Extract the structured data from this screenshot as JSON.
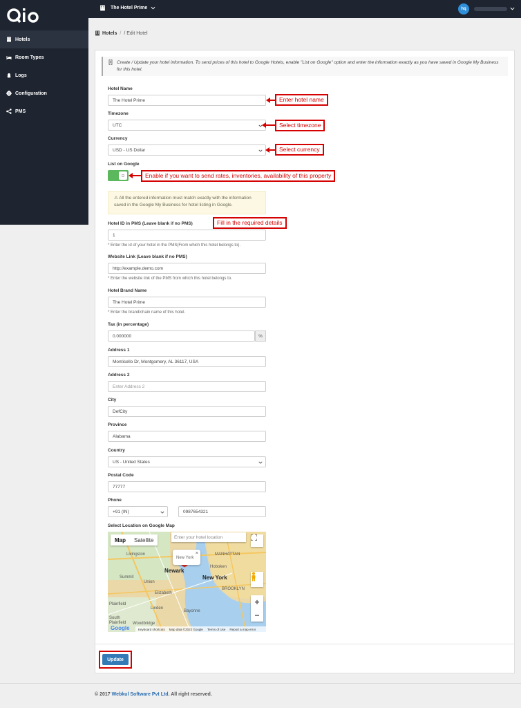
{
  "app": {
    "logo_text": "Qlo"
  },
  "topbar": {
    "hotel_name": "The Hotel Prime",
    "avatar_initials": "hq"
  },
  "sidebar": {
    "items": [
      {
        "label": "Hotels",
        "icon": "building-icon"
      },
      {
        "label": "Room Types",
        "icon": "bed-icon"
      },
      {
        "label": "Logs",
        "icon": "bell-icon"
      },
      {
        "label": "Configuration",
        "icon": "gear-icon"
      },
      {
        "label": "PMS",
        "icon": "share-icon"
      }
    ]
  },
  "breadcrumb": {
    "root": "Hotels",
    "sep": "/",
    "current": "/ Edit Hotel"
  },
  "info": "Create / Update your hotel information. To send prices of this hotel to Google Hotels, enable \"List on Google\" option and enter the information exactly as you have saved in Google My Business for this hotel.",
  "form": {
    "hotel_name": {
      "label": "Hotel Name",
      "value": "The Hotel Prime"
    },
    "timezone": {
      "label": "Timezone",
      "value": "UTC"
    },
    "currency": {
      "label": "Currency",
      "value": "USD - US Dollar"
    },
    "list_on_google": {
      "label": "List on Google",
      "enabled": true
    },
    "warning": "All the entered information must match exactly with the information saved in the Google My Business for hotel listing in Google.",
    "pms_id": {
      "label": "Hotel ID in PMS (Leave blank if no PMS)",
      "value": "1",
      "hint": "* Enter the id of your hotel in the PMS(From which this hotel belongs to)."
    },
    "website": {
      "label": "Website Link (Leave blank if no PMS)",
      "value": "http://example.demo.com",
      "hint": "* Enter the website link of the PMS from which this hotel belongs to."
    },
    "brand": {
      "label": "Hotel Brand Name",
      "value": "The Hotel Prime",
      "hint": "* Enter the brand/chain name of this hotel."
    },
    "tax": {
      "label": "Tax (in percentage)",
      "value": "0.000000",
      "addon": "%"
    },
    "address1": {
      "label": "Address 1",
      "value": "Monticello Dr, Montgomery, AL 36117, USA"
    },
    "address2": {
      "label": "Address 2",
      "placeholder": "Enter Address 2"
    },
    "city": {
      "label": "City",
      "value": "DefCity"
    },
    "province": {
      "label": "Province",
      "value": "Alabama"
    },
    "country": {
      "label": "Country",
      "value": "US - United States"
    },
    "postal": {
      "label": "Postal Code",
      "value": "77777"
    },
    "phone": {
      "label": "Phone",
      "code": "+91 (IN)",
      "value": "0987654321"
    },
    "map": {
      "label": "Select Location on Google Map",
      "tab_map": "Map",
      "tab_satellite": "Satellite",
      "search_placeholder": "Enter your hotel location",
      "popup": "New York",
      "popup_close": "×",
      "zoom_in": "+",
      "zoom_out": "−",
      "google": "Google",
      "footer": [
        "Keyboard shortcuts",
        "Map data ©2022 Google",
        "Terms of Use",
        "Report a map error"
      ],
      "places": [
        "Livingston",
        "Newark",
        "New York",
        "Union",
        "Summit",
        "Elizabeth",
        "Plainfield",
        "Linden",
        "Hoboken",
        "MANHATTAN",
        "BROOKLYN",
        "Woodbridge",
        "South Plainfield",
        "Bayonne"
      ]
    }
  },
  "annotations": {
    "hotel_name": "Enter hotel name",
    "timezone": "Select timezone",
    "currency": "Select currency",
    "google": "Enable if you want to send rates, inventories, availability of this property",
    "details": "Fill in the required details"
  },
  "actions": {
    "update": "Update"
  },
  "footer": {
    "prefix": "© 2017",
    "company": "Webkul Software Pvt Ltd",
    "suffix": ". All right reserved."
  }
}
